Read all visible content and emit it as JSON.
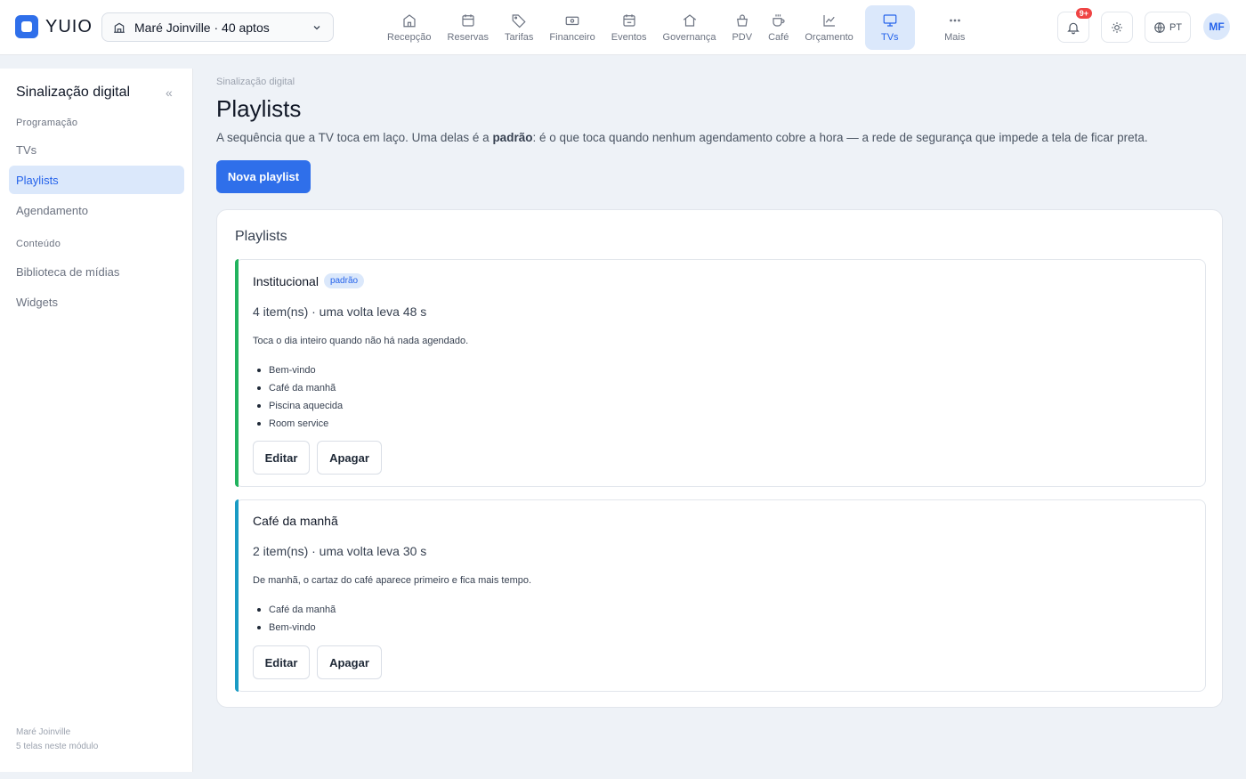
{
  "app": {
    "logo_text": "YUIO"
  },
  "property": {
    "selected": "Maré Joinville · 40 aptos"
  },
  "nav": [
    {
      "label": "Recepção",
      "icon": "home-icon"
    },
    {
      "label": "Reservas",
      "icon": "calendar-icon"
    },
    {
      "label": "Tarifas",
      "icon": "tag-icon"
    },
    {
      "label": "Financeiro",
      "icon": "money-icon"
    },
    {
      "label": "Eventos",
      "icon": "calendar-event-icon"
    },
    {
      "label": "Governança",
      "icon": "house-icon"
    },
    {
      "label": "PDV",
      "icon": "basket-icon"
    },
    {
      "label": "Café",
      "icon": "coffee-icon"
    },
    {
      "label": "Orçamento",
      "icon": "chart-line-icon"
    },
    {
      "label": "TVs",
      "icon": "monitor-icon",
      "active": true
    },
    {
      "label": "Mais",
      "icon": "more-icon"
    }
  ],
  "header": {
    "notification_badge": "9+",
    "language": "PT",
    "avatar_initials": "MF"
  },
  "sidebar": {
    "title": "Sinalização digital",
    "collapse_glyph": "«",
    "section_programacao": "Programação",
    "item_tvs": "TVs",
    "item_playlists": "Playlists",
    "item_agendamento": "Agendamento",
    "section_conteudo": "Conteúdo",
    "item_biblioteca": "Biblioteca de mídias",
    "item_widgets": "Widgets",
    "footer_property": "Maré Joinville",
    "footer_count": "5 telas neste módulo"
  },
  "main": {
    "breadcrumb": "Sinalização digital",
    "title": "Playlists",
    "intro_before": "A sequência que a TV toca em laço. Uma delas é a ",
    "intro_bold": "padrão",
    "intro_after": ": é o que toca quando nenhum agendamento cobre a hora — a rede de segurança que impede a tela de ficar preta.",
    "new_button": "Nova playlist",
    "panel_title": "Playlists"
  },
  "playlists": [
    {
      "name": "Institucional",
      "badge": "padrão",
      "meta": "4 item(ns) · uma volta leva 48 s",
      "description": "Toca o dia inteiro quando não há nada agendado.",
      "items": [
        "Bem-vindo",
        "Café da manhã",
        "Piscina aquecida",
        "Room service"
      ],
      "accent": "#22b35e",
      "edit_label": "Editar",
      "delete_label": "Apagar"
    },
    {
      "name": "Café da manhã",
      "meta": "2 item(ns) · uma volta leva 30 s",
      "description": "De manhã, o cartaz do café aparece primeiro e fica mais tempo.",
      "items": [
        "Café da manhã",
        "Bem-vindo"
      ],
      "accent": "#1a9bc4",
      "edit_label": "Editar",
      "delete_label": "Apagar"
    }
  ],
  "colors": {
    "primary": "#2f6fea",
    "active_bg": "#dbe8fb",
    "badge_red": "#ef4444"
  }
}
